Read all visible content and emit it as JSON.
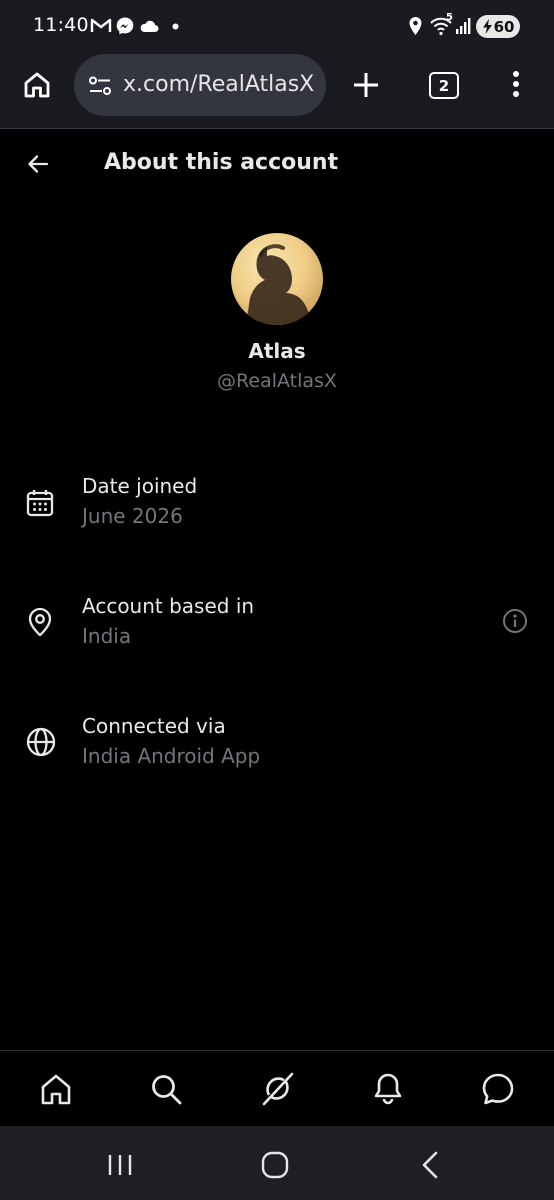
{
  "status_bar": {
    "time": "11:40",
    "network_label": "5",
    "battery_level": "60"
  },
  "browser": {
    "url": "x.com/RealAtlasX",
    "tab_count": "2"
  },
  "page": {
    "title": "About this account"
  },
  "profile": {
    "display_name": "Atlas",
    "handle": "@RealAtlasX"
  },
  "info_rows": [
    {
      "label": "Date joined",
      "value": "June 2026",
      "icon": "calendar-icon"
    },
    {
      "label": "Account based in",
      "value": "India",
      "icon": "location-pin-icon"
    },
    {
      "label": "Connected via",
      "value": "India Android App",
      "icon": "globe-icon"
    }
  ],
  "bottom_nav": [
    "home-icon",
    "search-icon",
    "grok-icon",
    "notifications-bell-icon",
    "messages-icon"
  ],
  "colors": {
    "background": "#000000",
    "primary_text": "#e7e9ea",
    "secondary_text": "#71767b",
    "browser_chrome": "#1a1b21",
    "url_pill": "#34363f"
  }
}
